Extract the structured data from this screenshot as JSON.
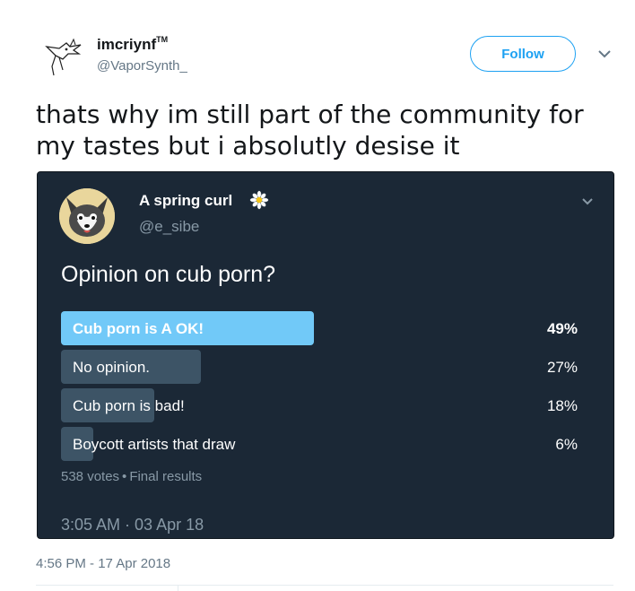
{
  "author": {
    "display_name": "imcriynf",
    "trademark": "TM",
    "handle": "@VaporSynth_",
    "avatar_icon": "dragon-sketch-avatar"
  },
  "follow_label": "Follow",
  "tweet_text": "thats why im still part of the community for my tastes but i absolutly desise it",
  "quoted": {
    "display_name": "A spring curl",
    "name_icon": "daisy-icon",
    "handle": "@e_sibe",
    "avatar_icon": "dog-avatar",
    "question": "Opinion on cub porn?",
    "options": [
      {
        "label": "Cub porn is A OK!",
        "percent_text": "49%",
        "percent": 49,
        "winner": true
      },
      {
        "label": "No opinion.",
        "percent_text": "27%",
        "percent": 27,
        "winner": false
      },
      {
        "label": "Cub porn is bad!",
        "percent_text": "18%",
        "percent": 18,
        "winner": false
      },
      {
        "label": "Boycott artists that draw",
        "percent_text": "6%",
        "percent": 6,
        "winner": false
      }
    ],
    "votes": "538 votes",
    "dot": "•",
    "status": "Final results",
    "timestamp": "3:05 AM · 03 Apr 18"
  },
  "timestamp": "4:56 PM - 17 Apr 2018",
  "colors": {
    "accent": "#1da1f2",
    "embed_bg": "#1b2836",
    "winner_bar": "#71c9f8",
    "other_bar": "#3d5466"
  }
}
